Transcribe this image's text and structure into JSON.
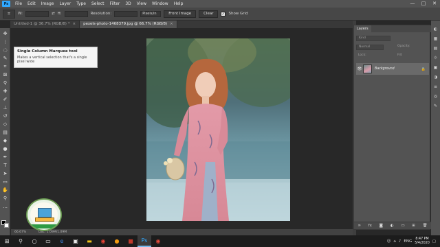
{
  "menubar": {
    "logo_text": "Ps",
    "items": [
      "File",
      "Edit",
      "Image",
      "Layer",
      "Type",
      "Select",
      "Filter",
      "3D",
      "View",
      "Window",
      "Help"
    ],
    "controls": [
      "—",
      "□",
      "✕"
    ]
  },
  "options": {
    "width_label": "W:",
    "height_label": "H:",
    "resolution_label": "Resolution:",
    "resolution_unit": "Pixels/in",
    "front_image": "Front Image",
    "clear": "Clear",
    "show_grid": "Show Grid"
  },
  "tabs": [
    {
      "label": "Untitled-1 @ 36.7% (RGB/8) *",
      "active": false
    },
    {
      "label": "pexels-photo-1468379.jpg @ 66.7% (RGB/8)",
      "active": true
    }
  ],
  "tooltip": {
    "title": "Single Column Marquee tool",
    "description": "Makes a vertical selection that's a single pixel wide"
  },
  "status": {
    "zoom": "66.67%",
    "doc": "Doc: 1.09M/1.09M"
  },
  "layers": {
    "tab_label": "Layers",
    "kind_placeholder": "Kind",
    "blend_mode": "Normal",
    "opacity_label": "Opacity:",
    "lock_label": "Lock:",
    "fill_label": "Fill:",
    "layer_name": "Background"
  },
  "taskbar": {
    "time": "8:47 PM",
    "date": "5/4/2020",
    "lang": "ENG"
  },
  "colors": {
    "accent": "#31a8ff",
    "panel": "#535353",
    "canvas_bg": "#282828"
  }
}
